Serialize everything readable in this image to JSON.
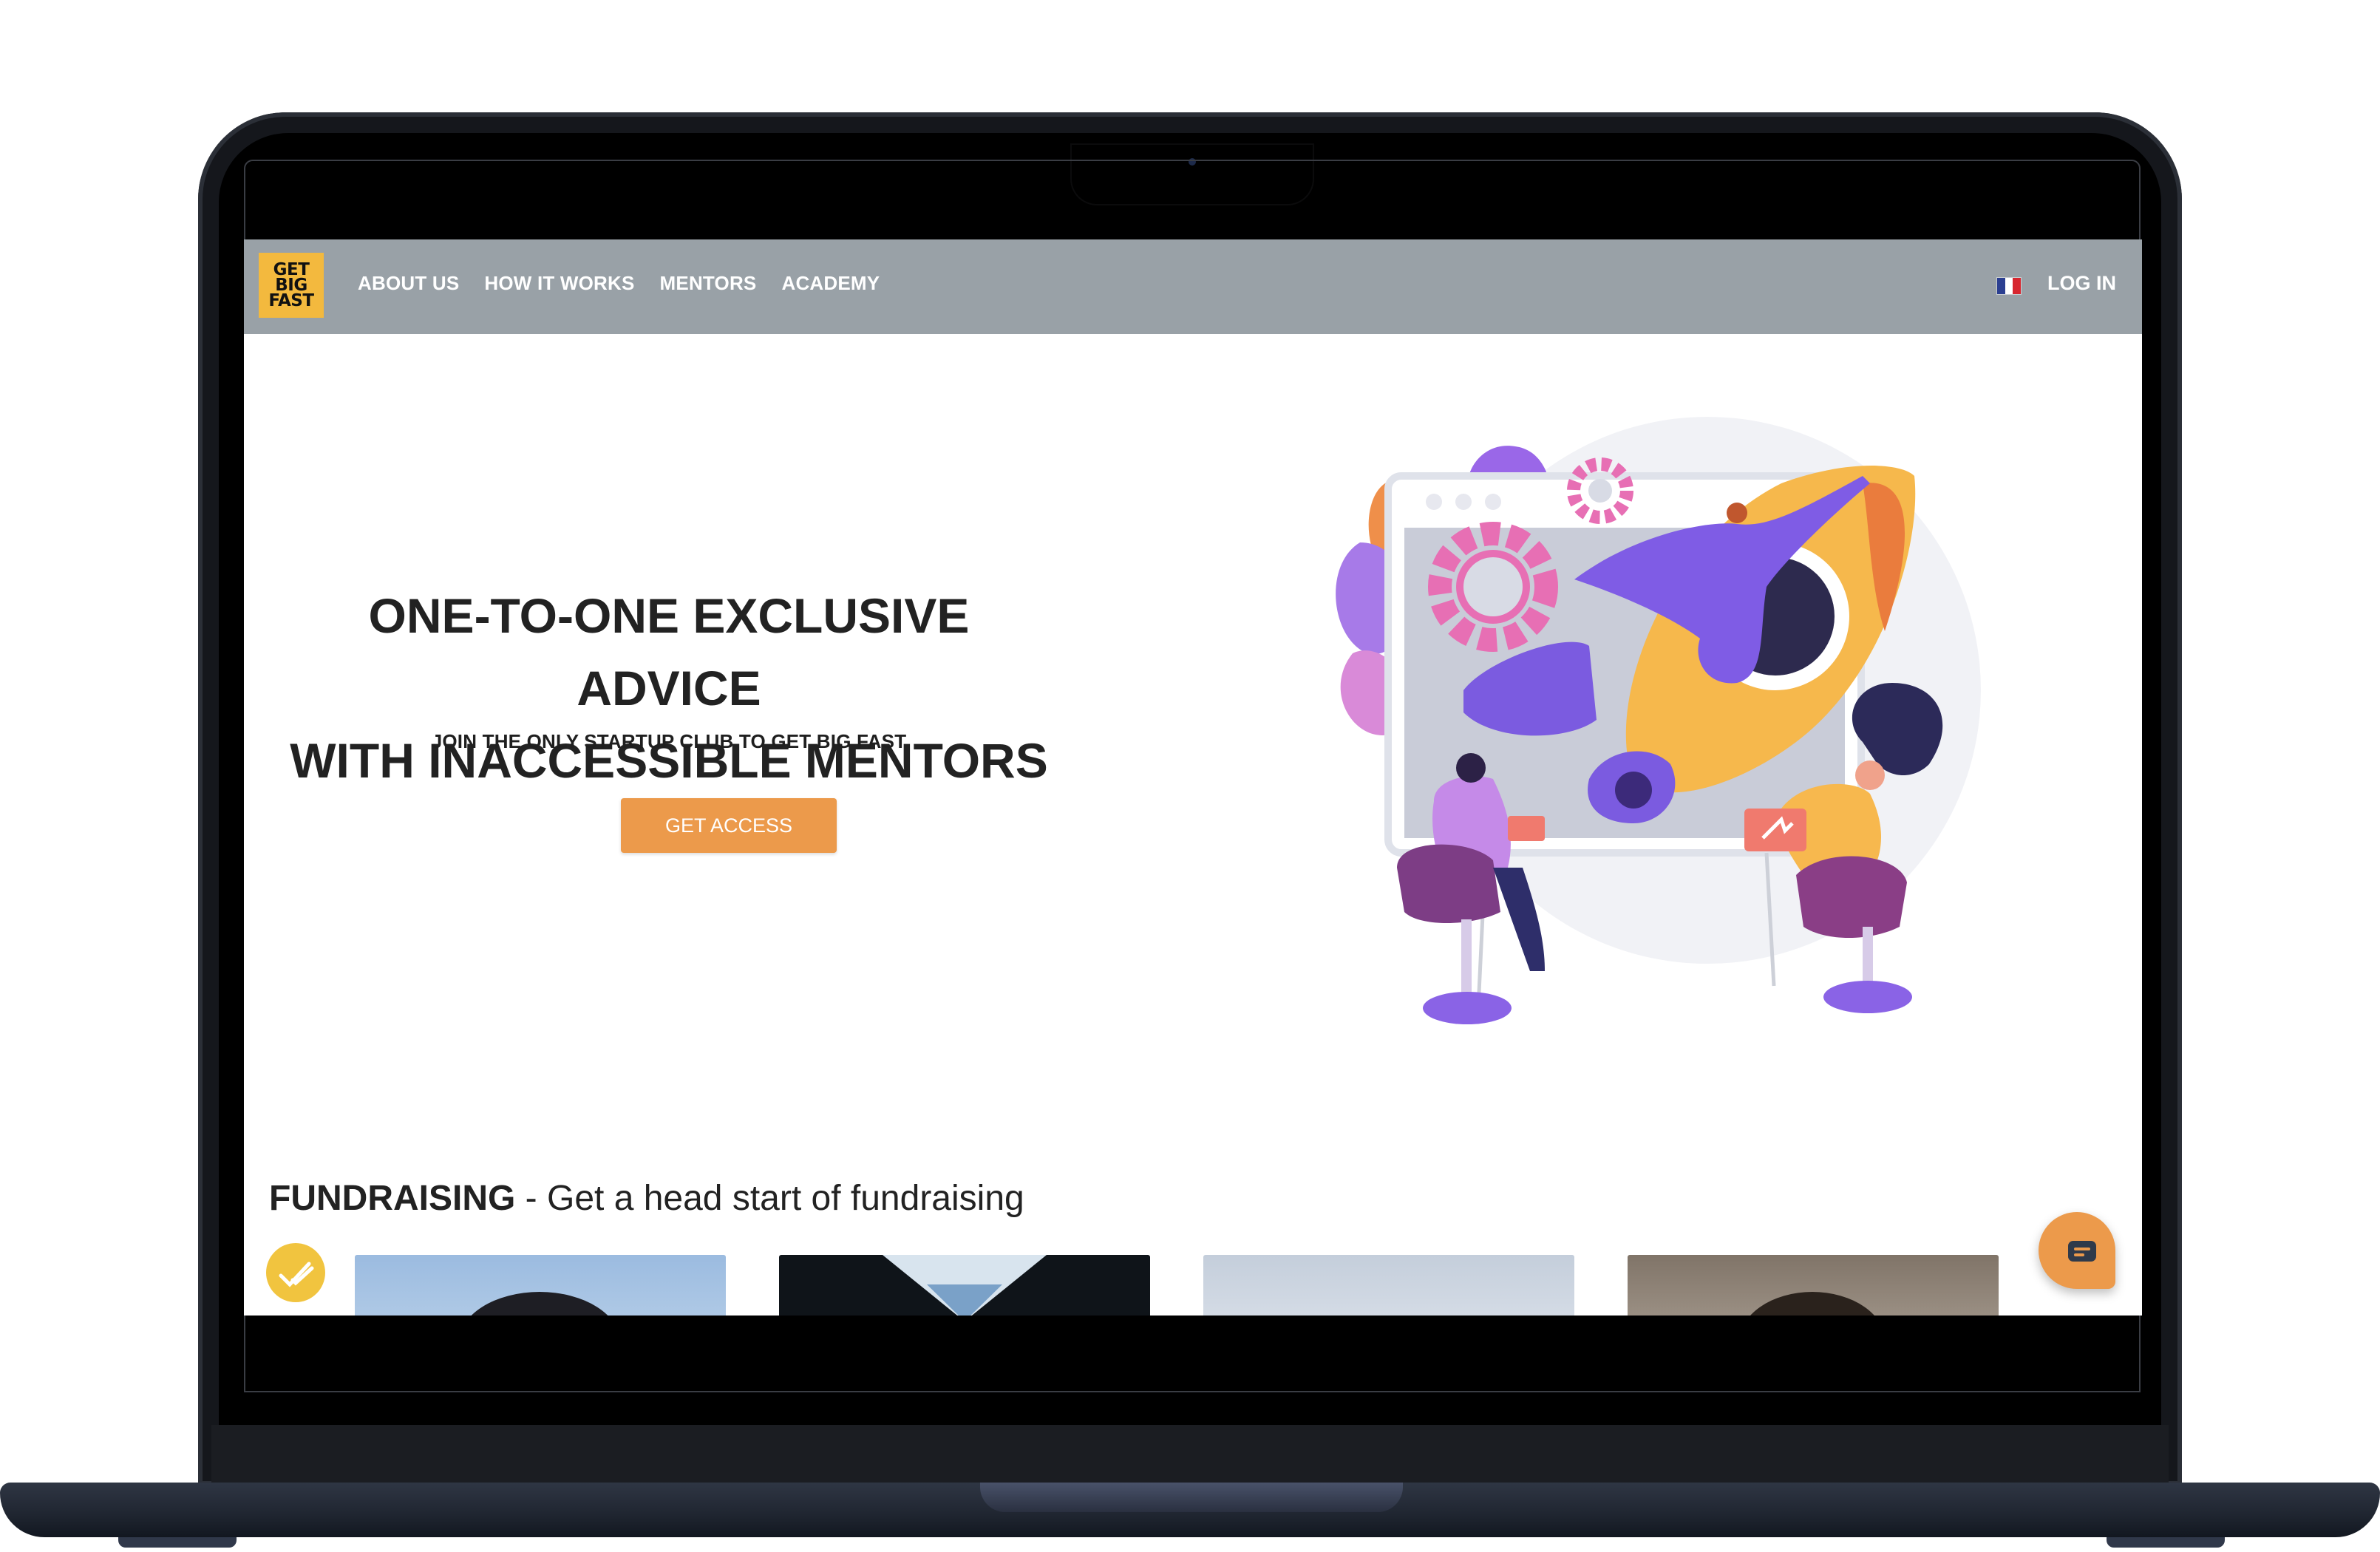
{
  "brand": {
    "logo_lines": [
      "GET",
      "BIG",
      "FAST"
    ],
    "logo_color": "#f3b93e"
  },
  "nav": {
    "items": [
      "ABOUT US",
      "HOW IT WORKS",
      "MENTORS",
      "ACADEMY"
    ],
    "language_icon": "french-flag-icon",
    "login_label": "LOG IN",
    "bar_color": "#99a1a7"
  },
  "hero": {
    "title_lines": [
      "ONE-TO-ONE EXCLUSIVE ADVICE",
      "WITH INACCESSIBLE MENTORS"
    ],
    "subtitle": "JOIN THE ONLY STARTUP CLUB TO GET BIG FAST",
    "cta_label": "GET ACCESS",
    "cta_color": "#ec9a4b",
    "illustration_icon": "team-meeting-rocket-illustration"
  },
  "fundraising": {
    "heading_bold": "FUNDRAISING",
    "heading_rest": " - Get a head start of fundraising",
    "badge_icon": "double-check-icon",
    "mentor_cards": [
      "mentor-photo-1",
      "mentor-photo-2",
      "mentor-photo-3",
      "mentor-photo-4"
    ]
  },
  "chat": {
    "icon": "chat-bubble-icon"
  }
}
